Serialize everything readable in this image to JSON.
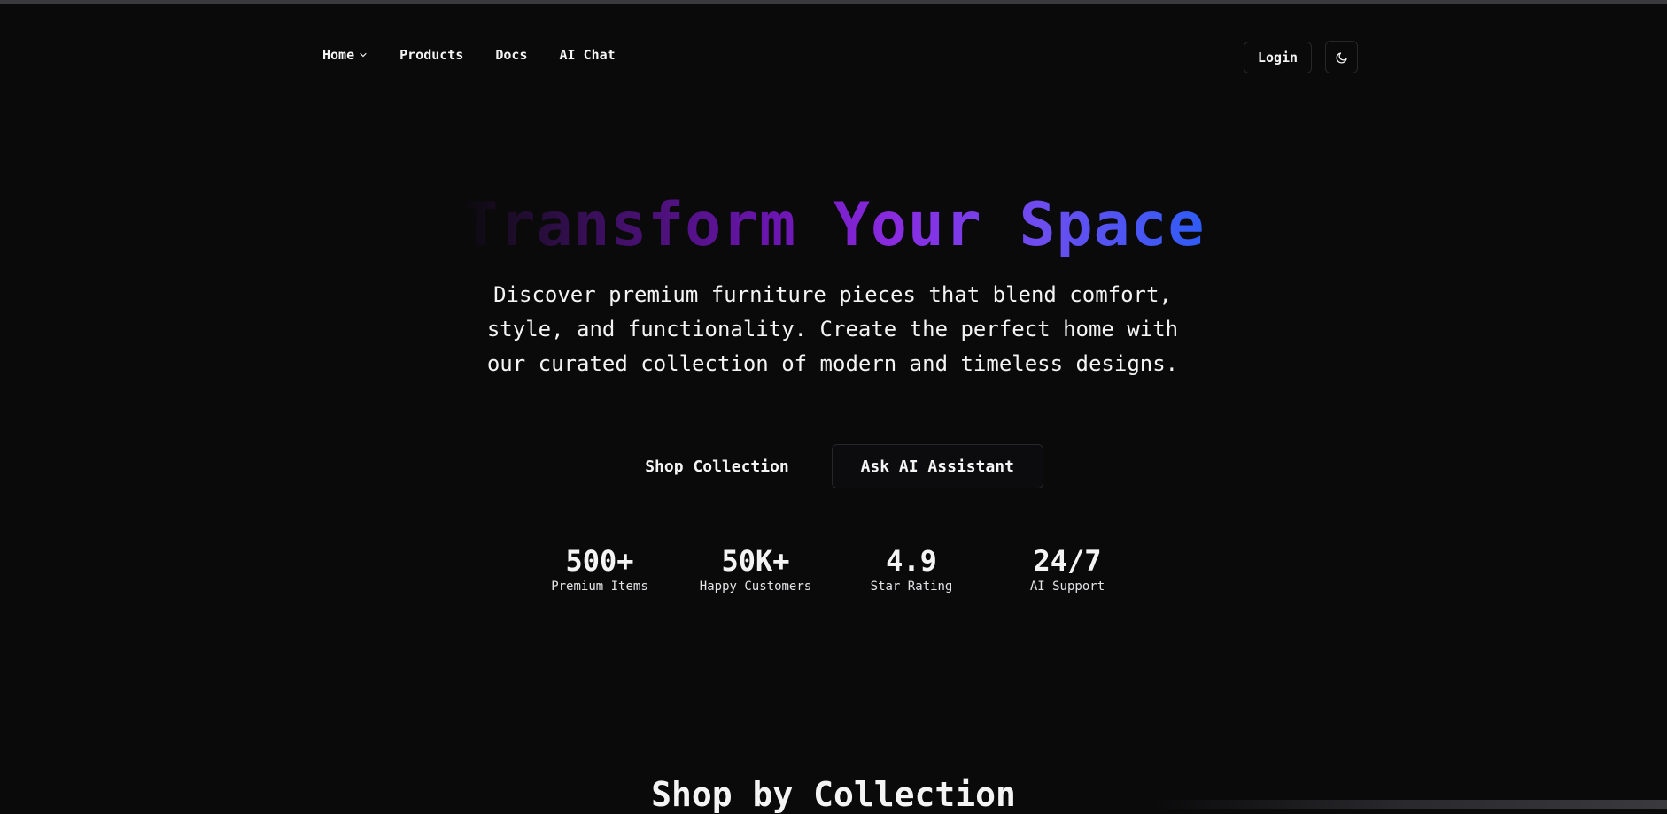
{
  "nav": {
    "links": [
      {
        "label": "Home",
        "has_dropdown": true
      },
      {
        "label": "Products"
      },
      {
        "label": "Docs"
      },
      {
        "label": "AI Chat"
      }
    ],
    "login_label": "Login",
    "theme_icon": "moon-icon"
  },
  "hero": {
    "title": "Transform Your Space",
    "subtitle": "Discover premium furniture pieces that blend comfort, style, and functionality. Create the perfect home with our curated collection of modern and timeless designs.",
    "primary_cta": "Shop Collection",
    "secondary_cta": "Ask AI Assistant",
    "gradient_colors": [
      "#0a0a0b",
      "#6b15b0",
      "#8a2be2",
      "#2f5cf6"
    ]
  },
  "stats": [
    {
      "value": "500+",
      "label": "Premium Items"
    },
    {
      "value": "50K+",
      "label": "Happy Customers"
    },
    {
      "value": "4.9",
      "label": "Star Rating"
    },
    {
      "value": "24/7",
      "label": "AI Support"
    }
  ],
  "collections": {
    "title": "Shop by Collection"
  },
  "colors": {
    "background": "#0a0a0b",
    "text": "#f4f4f5",
    "border": "#27272a"
  }
}
